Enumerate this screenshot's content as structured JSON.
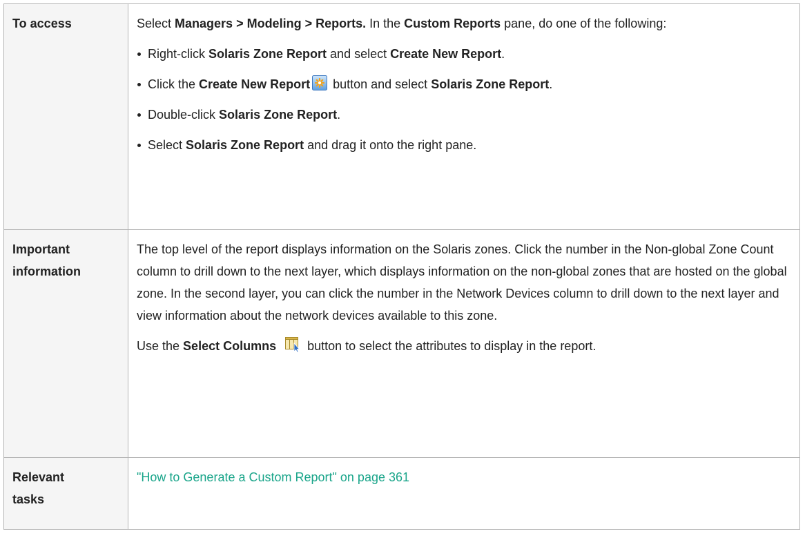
{
  "rows": [
    {
      "header": [
        "To access"
      ],
      "intro": {
        "t1": "Select ",
        "b1": "Managers > Modeling > Reports.",
        "t2": " In the ",
        "b2": "Custom Reports",
        "t3": " pane, do one of the following:"
      },
      "bullets": [
        {
          "t1": "Right-click ",
          "b1": "Solaris Zone Report",
          "t2": " and select ",
          "b2": "Create New Report",
          "t3": "."
        },
        {
          "t1": "Click the ",
          "b1": "Create New Report",
          "icon": "create-new-report-icon",
          "t2": " button and select ",
          "b2": "Solaris Zone Report",
          "t3": "."
        },
        {
          "t1": "Double-click ",
          "b1": "Solaris Zone Report",
          "t2": "."
        },
        {
          "t1": "Select ",
          "b1": "Solaris Zone Report",
          "t2": " and drag it onto the right pane."
        }
      ]
    },
    {
      "header": [
        "Important",
        "information"
      ],
      "para1": "The top level of the report displays information on the Solaris zones. Click the number in the Non-global Zone Count column to drill down to the next layer, which displays information on the non-global zones that are hosted on the global zone. In the second layer, you can click the number in the Network Devices column to drill down to the next layer and view information about the network devices available to this zone.",
      "para2": {
        "t1": "Use the ",
        "b1": "Select Columns",
        "icon": "select-columns-icon",
        "t2": " button to select the attributes to display in the report."
      }
    },
    {
      "header": [
        "Relevant",
        "tasks"
      ],
      "link": "\"How to Generate a Custom Report\" on page 361"
    }
  ],
  "colors": {
    "link": "#1aa58a",
    "header_bg": "#f5f5f5",
    "border": "#b3b3b3"
  }
}
